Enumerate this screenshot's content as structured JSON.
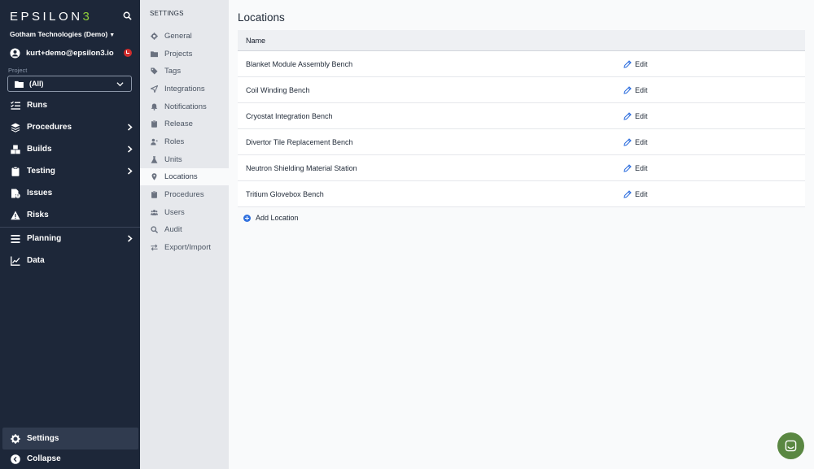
{
  "nav": {
    "logo_main": "EPSILON",
    "logo_accent": "3",
    "org": "Gotham Technologies (Demo)",
    "user": "kurt+demo@epsilon3.io",
    "project_label": "Project",
    "project_value": "(All)",
    "items": [
      {
        "label": "Runs",
        "icon": "checklist-icon"
      },
      {
        "label": "Procedures",
        "icon": "layers-icon"
      },
      {
        "label": "Builds",
        "icon": "cubes-icon"
      },
      {
        "label": "Testing",
        "icon": "clipboard-icon"
      },
      {
        "label": "Issues",
        "icon": "issue-icon"
      },
      {
        "label": "Risks",
        "icon": "warning-icon"
      },
      {
        "label": "Planning",
        "icon": "bars-icon"
      },
      {
        "label": "Data",
        "icon": "chart-icon"
      }
    ],
    "settings_label": "Settings",
    "collapse_label": "Collapse"
  },
  "settings": {
    "title": "SETTINGS",
    "items": [
      {
        "label": "General",
        "icon": "gear-icon"
      },
      {
        "label": "Projects",
        "icon": "folder-icon"
      },
      {
        "label": "Tags",
        "icon": "tag-icon"
      },
      {
        "label": "Integrations",
        "icon": "plug-icon"
      },
      {
        "label": "Notifications",
        "icon": "bell-icon"
      },
      {
        "label": "Release",
        "icon": "clipboard-icon"
      },
      {
        "label": "Roles",
        "icon": "user-plus-icon"
      },
      {
        "label": "Units",
        "icon": "flask-icon"
      },
      {
        "label": "Locations",
        "icon": "pin-icon"
      },
      {
        "label": "Procedures",
        "icon": "clipboard-icon"
      },
      {
        "label": "Users",
        "icon": "users-icon"
      },
      {
        "label": "Audit",
        "icon": "search-icon"
      },
      {
        "label": "Export/Import",
        "icon": "arrows-icon"
      }
    ]
  },
  "main": {
    "title": "Locations",
    "column_name": "Name",
    "edit_label": "Edit",
    "rows": [
      "Blanket Module Assembly Bench",
      "Coil Winding Bench",
      "Cryostat Integration Bench",
      "Divertor Tile Replacement Bench",
      "Neutron Shielding Material Station",
      "Tritium Glovebox Bench"
    ],
    "add_label": "Add Location"
  },
  "colors": {
    "nav_bg": "#1d2739",
    "accent_green": "#8fce3a",
    "link_blue": "#2f6fde",
    "chat_green": "#5a8742"
  }
}
